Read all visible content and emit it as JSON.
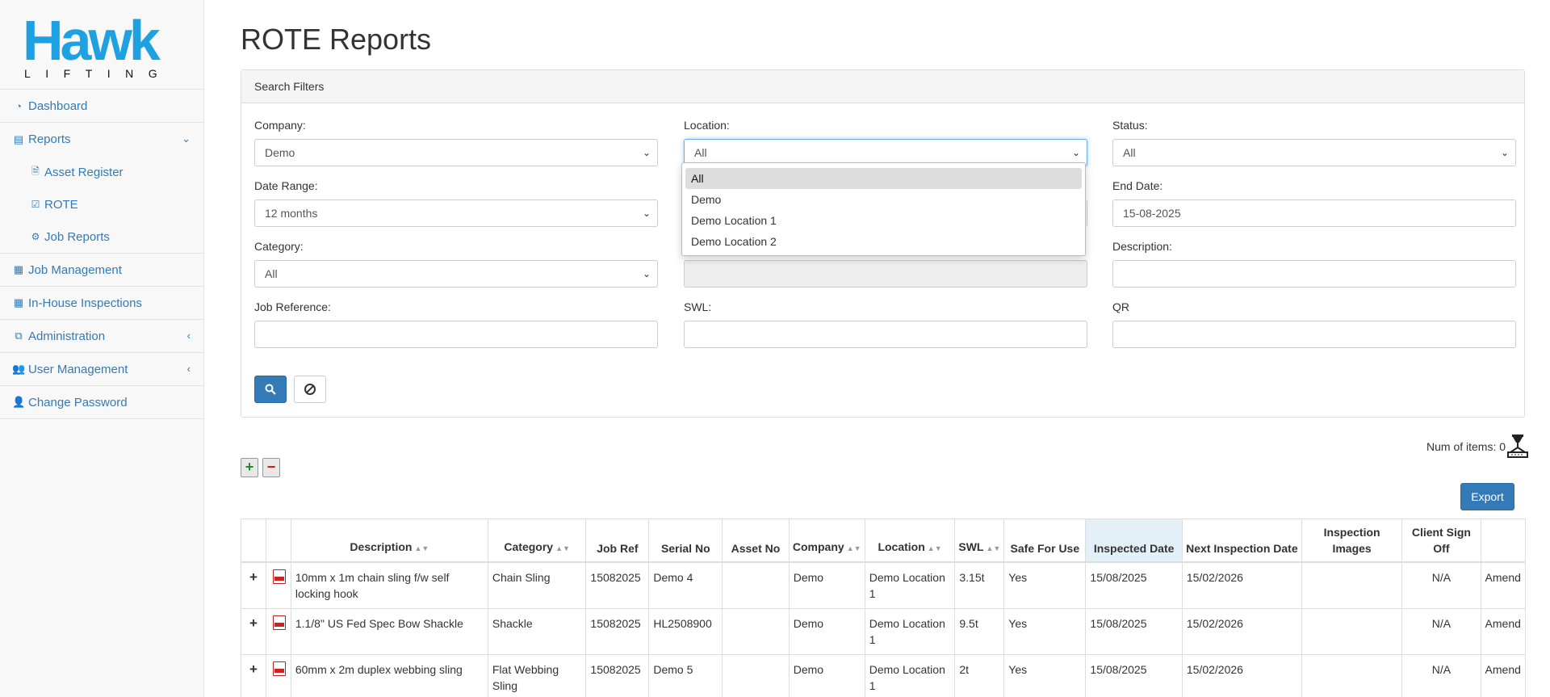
{
  "logo": {
    "word": "Hawk",
    "sub": "LIFTING"
  },
  "sidebar": {
    "dashboard": "Dashboard",
    "reports": "Reports",
    "asset_register": "Asset Register",
    "rote": "ROTE",
    "job_reports": "Job Reports",
    "job_management": "Job Management",
    "inhouse": "In-House Inspections",
    "administration": "Administration",
    "user_management": "User Management",
    "change_password": "Change Password"
  },
  "page": {
    "title": "ROTE Reports"
  },
  "filters": {
    "header": "Search Filters",
    "company": {
      "label": "Company:",
      "value": "Demo"
    },
    "location": {
      "label": "Location:",
      "value": "All",
      "options": [
        "All",
        "Demo",
        "Demo Location 1",
        "Demo Location 2"
      ]
    },
    "status": {
      "label": "Status:",
      "value": "All"
    },
    "date_range": {
      "label": "Date Range:",
      "value": "12 months"
    },
    "end_date": {
      "label": "End Date:",
      "value": "15-08-2025"
    },
    "category": {
      "label": "Category:",
      "value": "All"
    },
    "description": {
      "label": "Description:",
      "value": ""
    },
    "job_reference": {
      "label": "Job Reference:",
      "value": ""
    },
    "swl": {
      "label": "SWL:",
      "value": ""
    },
    "qr": {
      "label": "QR",
      "value": ""
    }
  },
  "toolbar": {
    "num_items_label": "Num of items: 0",
    "export_label": "Export"
  },
  "table": {
    "headers": [
      "Description",
      "Category",
      "Job Ref",
      "Serial No",
      "Asset No",
      "Company",
      "Location",
      "SWL",
      "Safe For Use",
      "Inspected Date",
      "Next Inspection Date",
      "Inspection Images",
      "Client Sign Off"
    ],
    "rows": [
      {
        "description": "10mm x 1m chain sling f/w self locking hook",
        "category": "Chain Sling",
        "job_ref": "15082025",
        "serial_no": "Demo 4",
        "asset_no": "",
        "company": "Demo",
        "location": "Demo Location 1",
        "swl": "3.15t",
        "safe": "Yes",
        "inspected": "15/08/2025",
        "next": "15/02/2026",
        "images": "",
        "signoff": "N/A",
        "action": "Amend"
      },
      {
        "description": "1.1/8\" US Fed Spec Bow Shackle",
        "category": "Shackle",
        "job_ref": "15082025",
        "serial_no": "HL2508900",
        "asset_no": "",
        "company": "Demo",
        "location": "Demo Location 1",
        "swl": "9.5t",
        "safe": "Yes",
        "inspected": "15/08/2025",
        "next": "15/02/2026",
        "images": "",
        "signoff": "N/A",
        "action": "Amend"
      },
      {
        "description": "60mm x 2m duplex webbing sling",
        "category": "Flat Webbing Sling",
        "job_ref": "15082025",
        "serial_no": "Demo 5",
        "asset_no": "",
        "company": "Demo",
        "location": "Demo Location 1",
        "swl": "2t",
        "safe": "Yes",
        "inspected": "15/08/2025",
        "next": "15/02/2026",
        "images": "",
        "signoff": "N/A",
        "action": "Amend"
      }
    ]
  }
}
